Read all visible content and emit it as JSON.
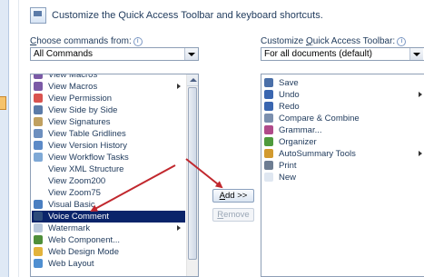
{
  "header": {
    "title": "Customize the Quick Access Toolbar and keyboard shortcuts."
  },
  "commands_panel": {
    "label_prefix": "C",
    "label_rest": "hoose commands from:",
    "dropdown_value": "All Commands",
    "items": [
      {
        "label": "View Macros",
        "icon": "macro-icon",
        "color": "#7b5aa6"
      },
      {
        "label": "View Macros",
        "icon": "macro-icon",
        "color": "#7b5aa6",
        "submenu": true
      },
      {
        "label": "View Permission",
        "icon": "permission-icon",
        "color": "#d9534f"
      },
      {
        "label": "View Side by Side",
        "icon": "side-by-side-icon",
        "color": "#5b7ba8"
      },
      {
        "label": "View Signatures",
        "icon": "signature-icon",
        "color": "#c0a060"
      },
      {
        "label": "View Table Gridlines",
        "icon": "gridlines-icon",
        "color": "#6d8fbf"
      },
      {
        "label": "View Version History",
        "icon": "history-icon",
        "color": "#5c8ac7"
      },
      {
        "label": "View Workflow Tasks",
        "icon": "workflow-icon",
        "color": "#7fa9d6"
      },
      {
        "label": "View XML Structure",
        "icon": "",
        "color": ""
      },
      {
        "label": "View Zoom200",
        "icon": "",
        "color": ""
      },
      {
        "label": "View Zoom75",
        "icon": "",
        "color": ""
      },
      {
        "label": "Visual Basic",
        "icon": "visual-basic-icon",
        "color": "#4a7fc1"
      },
      {
        "label": "Voice Comment",
        "icon": "voice-comment-icon",
        "color": "#2d4b7a",
        "selected": true
      },
      {
        "label": "Watermark",
        "icon": "watermark-icon",
        "color": "#b9c8dc",
        "submenu": true
      },
      {
        "label": "Web Component...",
        "icon": "web-component-icon",
        "color": "#4f8f3a"
      },
      {
        "label": "Web Design Mode",
        "icon": "design-mode-icon",
        "color": "#e2b33c"
      },
      {
        "label": "Web Layout",
        "icon": "web-layout-icon",
        "color": "#4f8fd1"
      }
    ]
  },
  "buttons": {
    "add_prefix": "A",
    "add_rest": "dd >>",
    "remove_prefix": "R",
    "remove_rest": "emove"
  },
  "toolbar_panel": {
    "label_before": "Customize ",
    "label_underlined": "Q",
    "label_after": "uick Access Toolbar:",
    "dropdown_value": "For all documents (default)",
    "items": [
      {
        "label": "Save",
        "icon": "save-icon",
        "color": "#4a6fa8"
      },
      {
        "label": "Undo",
        "icon": "undo-icon",
        "color": "#3a66b0",
        "submenu": true
      },
      {
        "label": "Redo",
        "icon": "redo-icon",
        "color": "#3a66b0"
      },
      {
        "label": "Compare & Combine",
        "icon": "compare-icon",
        "color": "#7b8fae"
      },
      {
        "label": "Grammar...",
        "icon": "grammar-icon",
        "color": "#b04a8a"
      },
      {
        "label": "Organizer",
        "icon": "organizer-icon",
        "color": "#4e9a3c"
      },
      {
        "label": "AutoSummary Tools",
        "icon": "autosummary-icon",
        "color": "#d29a2f",
        "submenu": true
      },
      {
        "label": "Print",
        "icon": "print-icon",
        "color": "#6d7d92"
      },
      {
        "label": "New",
        "icon": "new-document-icon",
        "color": "#dfe7f1"
      }
    ]
  },
  "colors": {
    "selection": "#0a246a",
    "annotation_arrow": "#c1272d"
  }
}
